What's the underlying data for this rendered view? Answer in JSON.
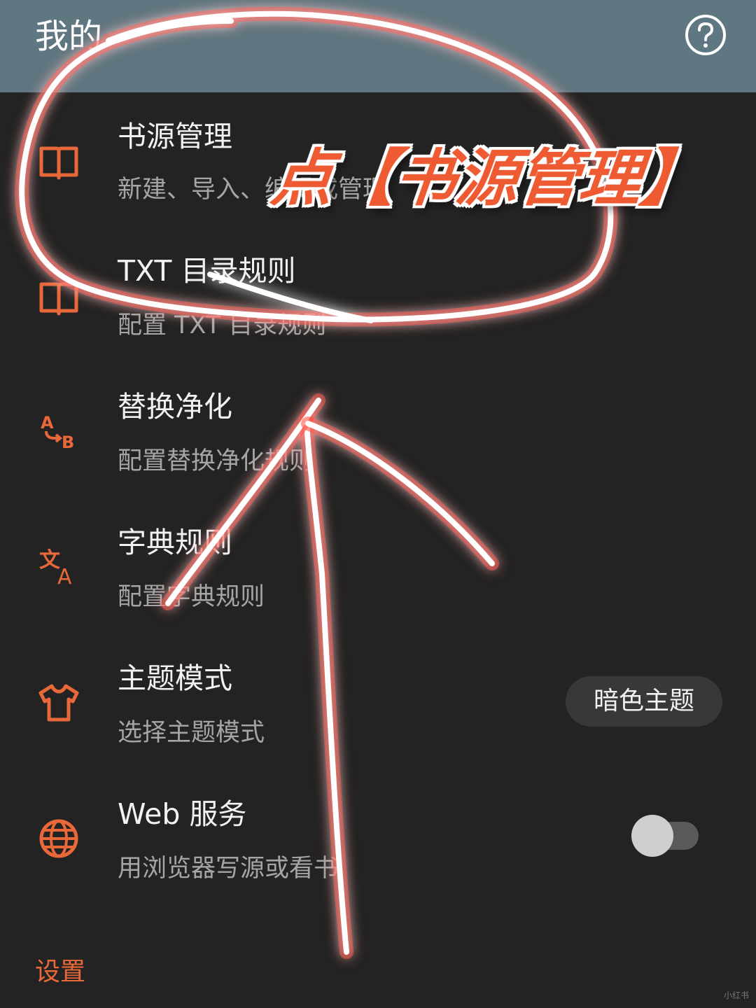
{
  "header": {
    "title": "我的",
    "help_icon": "help-circle-icon"
  },
  "accent_color": "#e8683a",
  "items": [
    {
      "title": "书源管理",
      "desc": "新建、导入、编辑或管理",
      "icon": "book-open-icon"
    },
    {
      "title": "TXT 目录规则",
      "desc": "配置 TXT 目录规则",
      "icon": "book-open-icon"
    },
    {
      "title": "替换净化",
      "desc": "配置替换净化规则",
      "icon": "replace-icon"
    },
    {
      "title": "字典规则",
      "desc": "配置字典规则",
      "icon": "translate-icon"
    },
    {
      "title": "主题模式",
      "desc": "选择主题模式",
      "icon": "tshirt-icon",
      "value": "暗色主题"
    },
    {
      "title": "Web 服务",
      "desc": "用浏览器写源或看书",
      "icon": "globe-icon",
      "toggle_on": false
    }
  ],
  "section_label": "设置",
  "annotation": {
    "text": "点【书源管理】",
    "color": "#ee5a32"
  },
  "watermark": "小红书"
}
